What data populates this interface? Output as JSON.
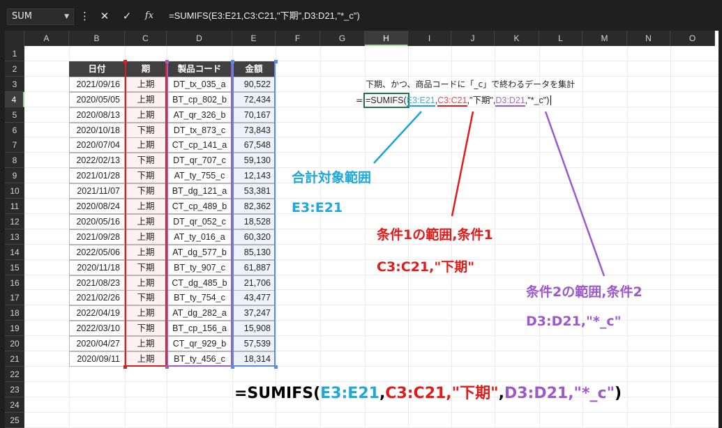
{
  "formula_bar": {
    "name_box": "SUM",
    "cancel_glyph": "✕",
    "enter_glyph": "✓",
    "fx_glyph": "fx",
    "more_glyph": "⋮",
    "formula": "=SUMIFS(E3:E21,C3:C21,\"下期\",D3:D21,\"*_c\")"
  },
  "columns": [
    "A",
    "B",
    "C",
    "D",
    "E",
    "F",
    "G",
    "H",
    "I",
    "J",
    "K",
    "L",
    "M",
    "N",
    "O"
  ],
  "selected_column": "H",
  "rows": [
    "1",
    "2",
    "3",
    "4",
    "5",
    "6",
    "7",
    "8",
    "9",
    "10",
    "11",
    "12",
    "13",
    "14",
    "15",
    "16",
    "17",
    "18",
    "19",
    "20",
    "21",
    "22",
    "23",
    "24",
    "25"
  ],
  "selected_row": "4",
  "table": {
    "headers": [
      "日付",
      "期",
      "製品コード",
      "金額"
    ],
    "rows": [
      [
        "2021/09/16",
        "上期",
        "DT_tx_035_a",
        "90,522"
      ],
      [
        "2020/05/05",
        "上期",
        "BT_cp_802_b",
        "72,434"
      ],
      [
        "2020/08/13",
        "上期",
        "AT_qr_326_b",
        "70,167"
      ],
      [
        "2020/10/18",
        "下期",
        "DT_tx_873_c",
        "73,843"
      ],
      [
        "2020/07/04",
        "上期",
        "CT_cp_141_a",
        "67,548"
      ],
      [
        "2022/02/13",
        "下期",
        "DT_qr_707_c",
        "59,130"
      ],
      [
        "2021/01/28",
        "下期",
        "AT_ty_755_c",
        "12,143"
      ],
      [
        "2021/11/07",
        "下期",
        "BT_dg_121_a",
        "53,381"
      ],
      [
        "2020/08/24",
        "上期",
        "CT_cp_489_b",
        "82,362"
      ],
      [
        "2020/05/16",
        "上期",
        "DT_qr_052_c",
        "18,528"
      ],
      [
        "2021/09/28",
        "上期",
        "AT_ty_016_a",
        "60,320"
      ],
      [
        "2022/05/06",
        "上期",
        "AT_dg_577_b",
        "85,130"
      ],
      [
        "2020/11/18",
        "下期",
        "BT_ty_907_c",
        "61,887"
      ],
      [
        "2021/08/23",
        "上期",
        "CT_dg_485_b",
        "21,706"
      ],
      [
        "2021/02/26",
        "下期",
        "BT_ty_754_c",
        "43,477"
      ],
      [
        "2022/04/19",
        "上期",
        "AT_dg_282_a",
        "37,247"
      ],
      [
        "2022/03/10",
        "下期",
        "BT_cp_156_a",
        "15,908"
      ],
      [
        "2020/04/27",
        "上期",
        "CT_qr_929_b",
        "57,539"
      ],
      [
        "2020/09/11",
        "上期",
        "BT_ty_456_c",
        "18,314"
      ]
    ]
  },
  "description": "下期、かつ、商品コードに「_c」で終わるデータを集計",
  "editing_cell": {
    "prefix": "=",
    "fn": "=SUMIFS(",
    "arg1": "E3:E21",
    "comma1": ",",
    "arg2": "C3:C21",
    "crit1": ",\"下期\",",
    "arg3": "D3:D21",
    "crit2": ",\"*_c\")"
  },
  "annotations": {
    "sum_range_title": "合計対象範囲",
    "sum_range_value": "E3:E21",
    "cond1_title": "条件1の範囲,条件1",
    "cond1_value": "C3:C21,\"下期\"",
    "cond2_title": "条件2の範囲,条件2",
    "cond2_value": "D3:D21,\"*_c\""
  },
  "big_formula": {
    "p1": "=SUMIFS(",
    "p2": "E3:E21",
    "p3": ",",
    "p4": "C3:C21,\"下期\"",
    "p5": ",",
    "p6": "D3:D21,\"*_c\"",
    "p7": ")"
  },
  "colors": {
    "blue": "#1ea7dd",
    "red": "#e01b1b",
    "purple": "#9b59cc",
    "header_dark": "#404040",
    "select_green": "#217346"
  }
}
